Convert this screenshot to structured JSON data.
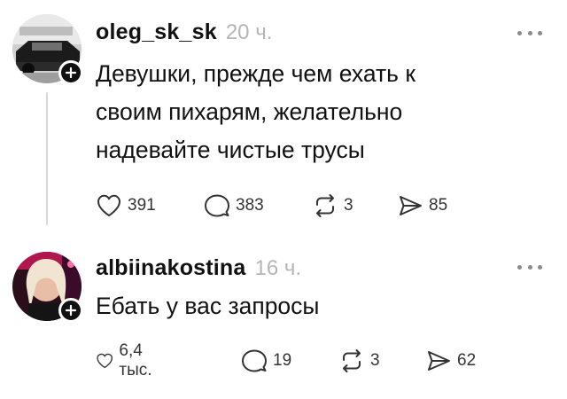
{
  "posts": [
    {
      "username": "oleg_sk_sk",
      "time": "20 ч.",
      "lines": [
        "Девушки, прежде чем ехать к",
        "своим пихарям, желательно",
        "надевайте чистые трусы"
      ],
      "likes": "391",
      "comments": "383",
      "reposts": "3",
      "shares": "85"
    },
    {
      "username": "albiinakostina",
      "time": "16 ч.",
      "lines": [
        "Ебать у вас запросы"
      ],
      "likes": "6,4 тыс.",
      "comments": "19",
      "reposts": "3",
      "shares": "62"
    }
  ],
  "icons": {
    "like": "heart-icon",
    "comment": "speech-bubble-icon",
    "repost": "repost-icon",
    "share": "send-icon",
    "more": "more-dots-icon",
    "follow": "plus-icon"
  }
}
